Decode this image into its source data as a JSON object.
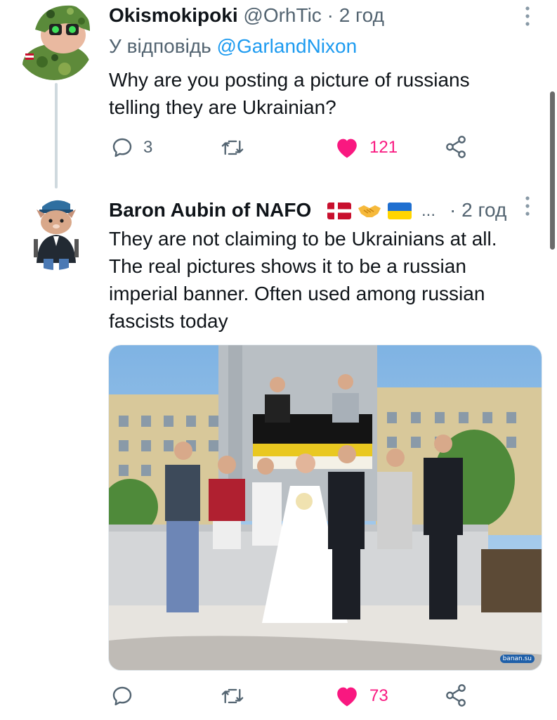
{
  "tweet1": {
    "display_name": "Okismokipoki",
    "handle": "@OrhTic",
    "separator": "·",
    "time": "2 год",
    "reply_prefix": "У відповідь",
    "reply_mention": "@GarlandNixon",
    "text_line1": "Why are you posting a picture of russians",
    "text_line2": "telling they are Ukrainian?",
    "replies": "3",
    "retweets": "",
    "likes": "121",
    "icons": [
      "reply-icon",
      "retweet-icon",
      "heart-icon",
      "share-icon",
      "more-icon"
    ]
  },
  "tweet2": {
    "display_name": "Baron Aubin of NAFO",
    "flags": [
      "denmark-flag",
      "handshake-emoji",
      "ukraine-flag"
    ],
    "ellipsis": "...",
    "separator": "·",
    "time": "2 год",
    "text_lines": [
      "They are not claiming to be Ukrainians at all.",
      "The real pictures shows it to be a russian",
      "imperial banner. Often used among russian",
      "fascists today"
    ],
    "replies": "",
    "retweets": "",
    "likes": "73",
    "photo_watermark": "banan.su"
  },
  "colors": {
    "text": "#0f1419",
    "secondary": "#536471",
    "link": "#1d9bf0",
    "like": "#f91880",
    "thread_line": "#cfd9de"
  }
}
